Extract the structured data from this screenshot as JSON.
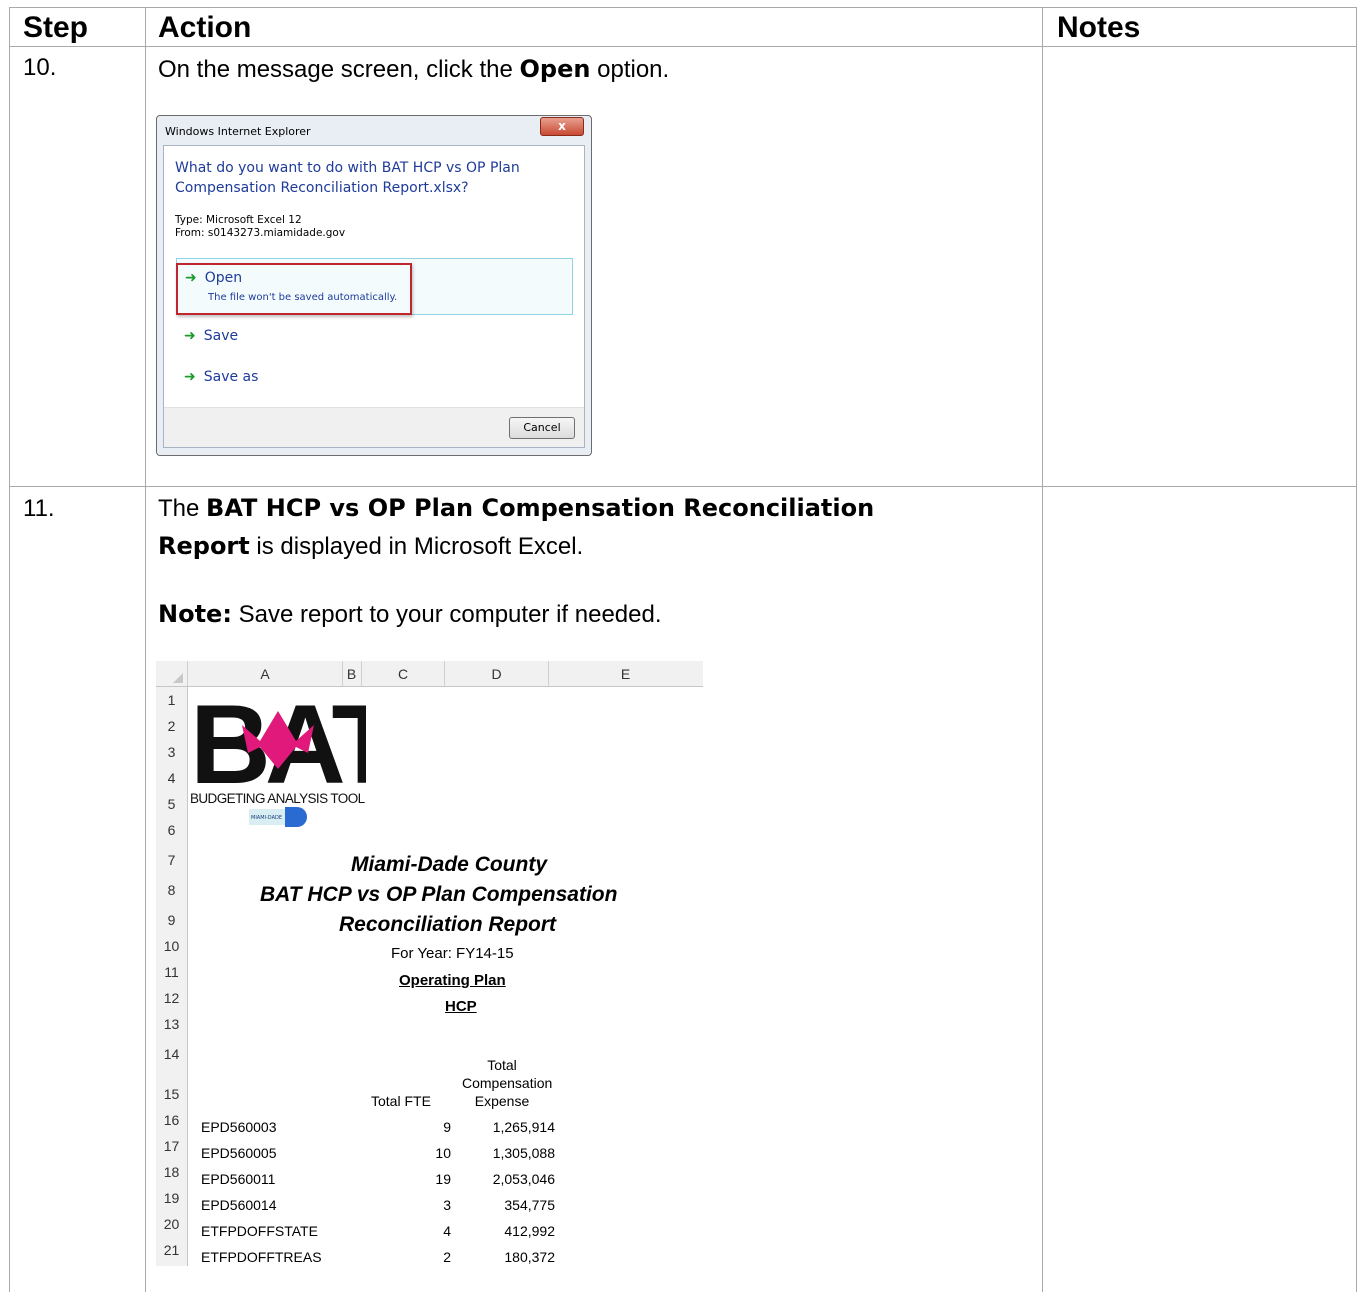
{
  "table": {
    "headers": {
      "step": "Step",
      "action": "Action",
      "notes": "Notes"
    }
  },
  "step10": {
    "number": "10.",
    "text_pre": "On the message screen, click the ",
    "text_bold": "Open",
    "text_post": " option."
  },
  "dialog": {
    "title": "Windows Internet Explorer",
    "close_glyph": "x",
    "question": "What do you want to do with BAT HCP vs OP Plan Compensation Reconciliation Report.xlsx?",
    "type_line": "Type: Microsoft Excel 12",
    "from_line": "From: s0143273.miamidade.gov",
    "open_label": "Open",
    "open_sub": "The file won't be saved automatically.",
    "save_label": "Save",
    "save_as_label": "Save as",
    "cancel_label": "Cancel",
    "arrow_icon": "green-right-arrow"
  },
  "step11": {
    "number": "11.",
    "line1_pre": "The ",
    "line1_bold": "BAT HCP vs OP Plan Compensation Reconciliation",
    "line2_bold": "Report",
    "line2_post": " is displayed in Microsoft Excel.",
    "note_label": "Note:",
    "note_text": " Save report to your computer if needed."
  },
  "excel": {
    "columns": [
      "A",
      "B",
      "C",
      "D",
      "E"
    ],
    "rows": [
      "1",
      "2",
      "3",
      "4",
      "5",
      "6",
      "7",
      "8",
      "9",
      "10",
      "11",
      "12",
      "13",
      "14",
      "15",
      "16",
      "17",
      "18",
      "19",
      "20",
      "21"
    ],
    "logo_text": "BAT",
    "logo_caption": "BUDGETING ANALYSIS TOOL",
    "county_logo_text": "MIAMI-DADE",
    "title1": "Miami-Dade County",
    "title2": "BAT HCP vs OP Plan Compensation",
    "title3": "Reconciliation Report",
    "year_line": "For Year: FY14-15",
    "plan_line": "Operating Plan",
    "hcp_line": "HCP",
    "col_fte": "Total FTE",
    "col_comp_1": "Total",
    "col_comp_2": "Compensation",
    "col_comp_3": "Expense",
    "data": [
      {
        "name": "EPD560003",
        "fte": "9",
        "expense": "1,265,914"
      },
      {
        "name": "EPD560005",
        "fte": "10",
        "expense": "1,305,088"
      },
      {
        "name": "EPD560011",
        "fte": "19",
        "expense": "2,053,046"
      },
      {
        "name": "EPD560014",
        "fte": "3",
        "expense": "354,775"
      },
      {
        "name": "ETFPDOFFSTATE",
        "fte": "4",
        "expense": "412,992"
      },
      {
        "name": "ETFPDOFFTREAS",
        "fte": "2",
        "expense": "180,372"
      }
    ]
  }
}
